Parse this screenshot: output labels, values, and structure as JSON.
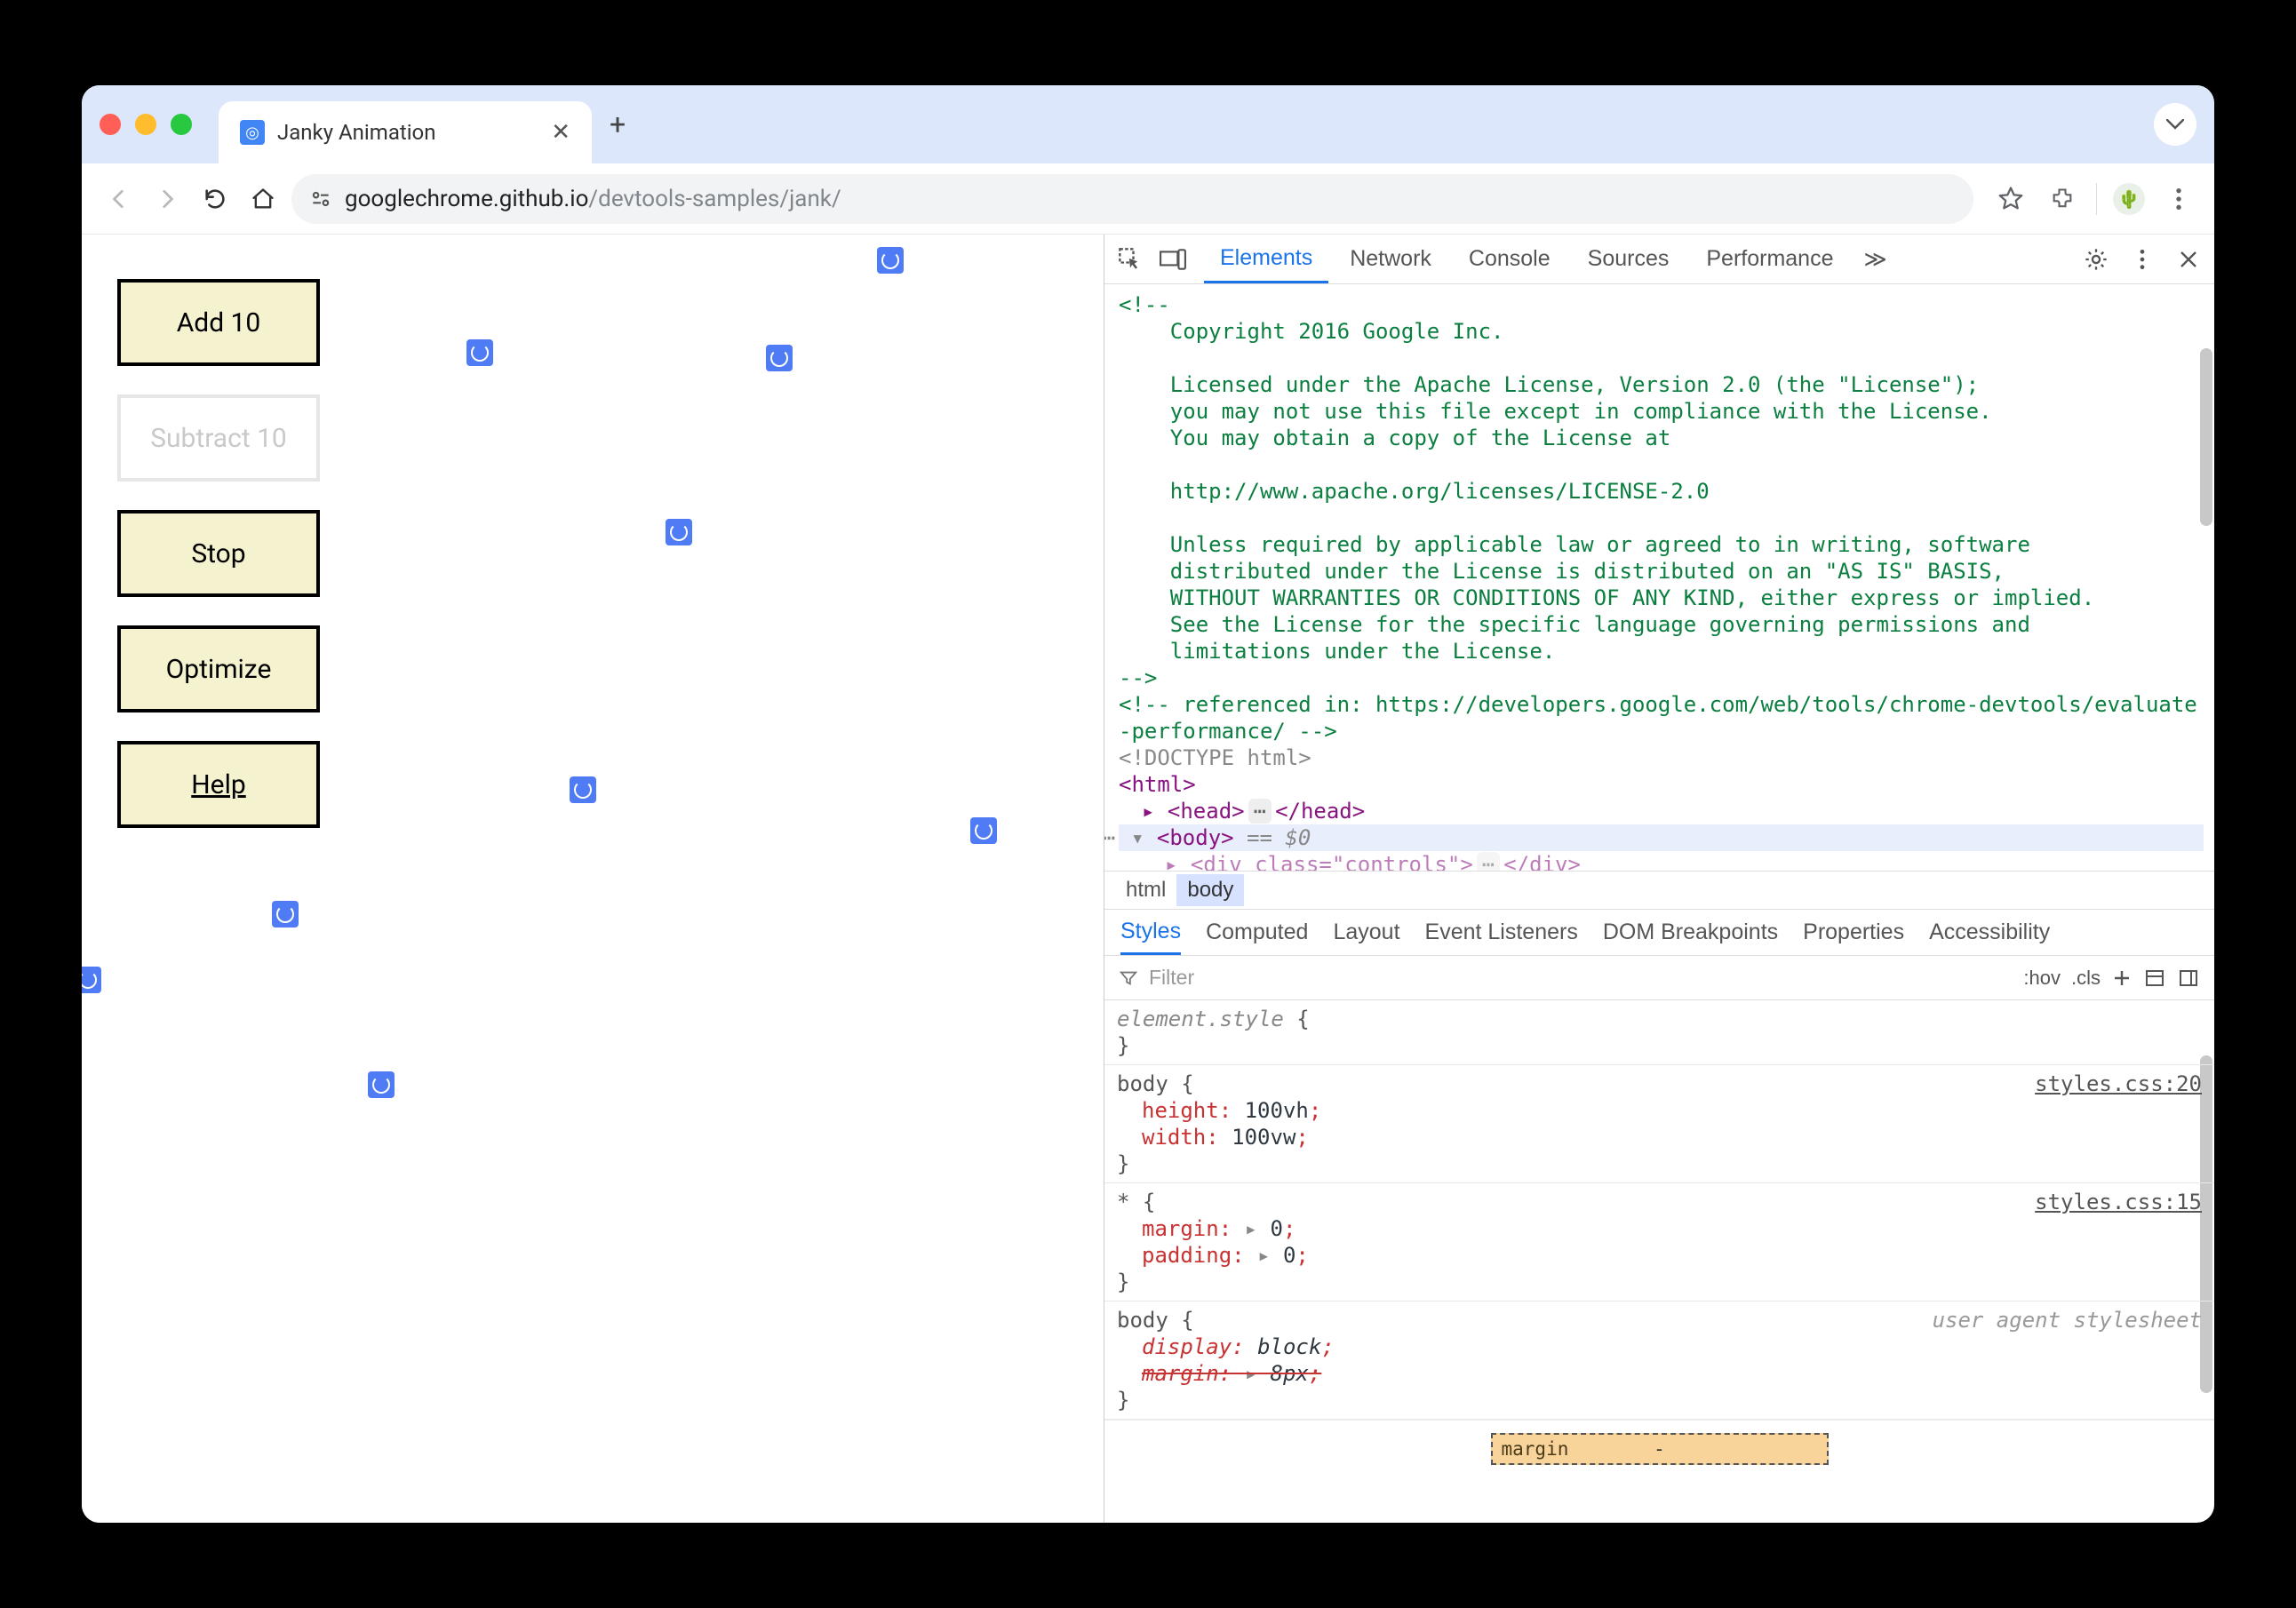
{
  "tab": {
    "title": "Janky Animation"
  },
  "url": {
    "host": "googlechrome.github.io",
    "path": "/devtools-samples/jank/"
  },
  "page_controls": {
    "add": "Add 10",
    "subtract": "Subtract 10",
    "stop": "Stop",
    "optimize": "Optimize",
    "help": "Help"
  },
  "devtools": {
    "tabs": [
      "Elements",
      "Network",
      "Console",
      "Sources",
      "Performance"
    ],
    "active_tab": "Elements",
    "overflow": "≫",
    "dom": {
      "comment_block": "<!--\n    Copyright 2016 Google Inc.\n\n    Licensed under the Apache License, Version 2.0 (the \"License\");\n    you may not use this file except in compliance with the License.\n    You may obtain a copy of the License at\n\n    http://www.apache.org/licenses/LICENSE-2.0\n\n    Unless required by applicable law or agreed to in writing, software\n    distributed under the License is distributed on an \"AS IS\" BASIS,\n    WITHOUT WARRANTIES OR CONDITIONS OF ANY KIND, either express or implied.\n    See the License for the specific language governing permissions and\n    limitations under the License.\n-->",
      "comment_ref": "<!-- referenced in: https://developers.google.com/web/tools/chrome-devtools/evaluate-performance/ -->",
      "doctype": "<!DOCTYPE html>",
      "html_open": "<html>",
      "head_open": "<head>",
      "head_close": "</head>",
      "body_open": "<body>",
      "selected_hint": "== $0",
      "child_div": "<div class=\"controls\">",
      "child_div_close": "</div>"
    },
    "crumbs": [
      "html",
      "body"
    ],
    "active_crumb": "body",
    "subpanels": [
      "Styles",
      "Computed",
      "Layout",
      "Event Listeners",
      "DOM Breakpoints",
      "Properties",
      "Accessibility"
    ],
    "active_subpanel": "Styles",
    "filter_placeholder": "Filter",
    "filter_tools": {
      "hov": ":hov",
      "cls": ".cls"
    },
    "styles": {
      "element_style": {
        "selector": "element.style",
        "props": []
      },
      "body_rule": {
        "selector": "body",
        "src": "styles.css:20",
        "props": [
          {
            "name": "height",
            "value": "100vh"
          },
          {
            "name": "width",
            "value": "100vw"
          }
        ]
      },
      "star_rule": {
        "selector": "*",
        "src": "styles.css:15",
        "props": [
          {
            "name": "margin",
            "value": "0",
            "tri": true
          },
          {
            "name": "padding",
            "value": "0",
            "tri": true
          }
        ]
      },
      "ua_rule": {
        "selector": "body",
        "src": "user agent stylesheet",
        "props": [
          {
            "name": "display",
            "value": "block",
            "italic": true
          },
          {
            "name": "margin",
            "value": "8px",
            "strike": true,
            "tri": true
          }
        ]
      }
    },
    "boxmodel": {
      "margin_label": "margin",
      "dash": "-"
    }
  }
}
